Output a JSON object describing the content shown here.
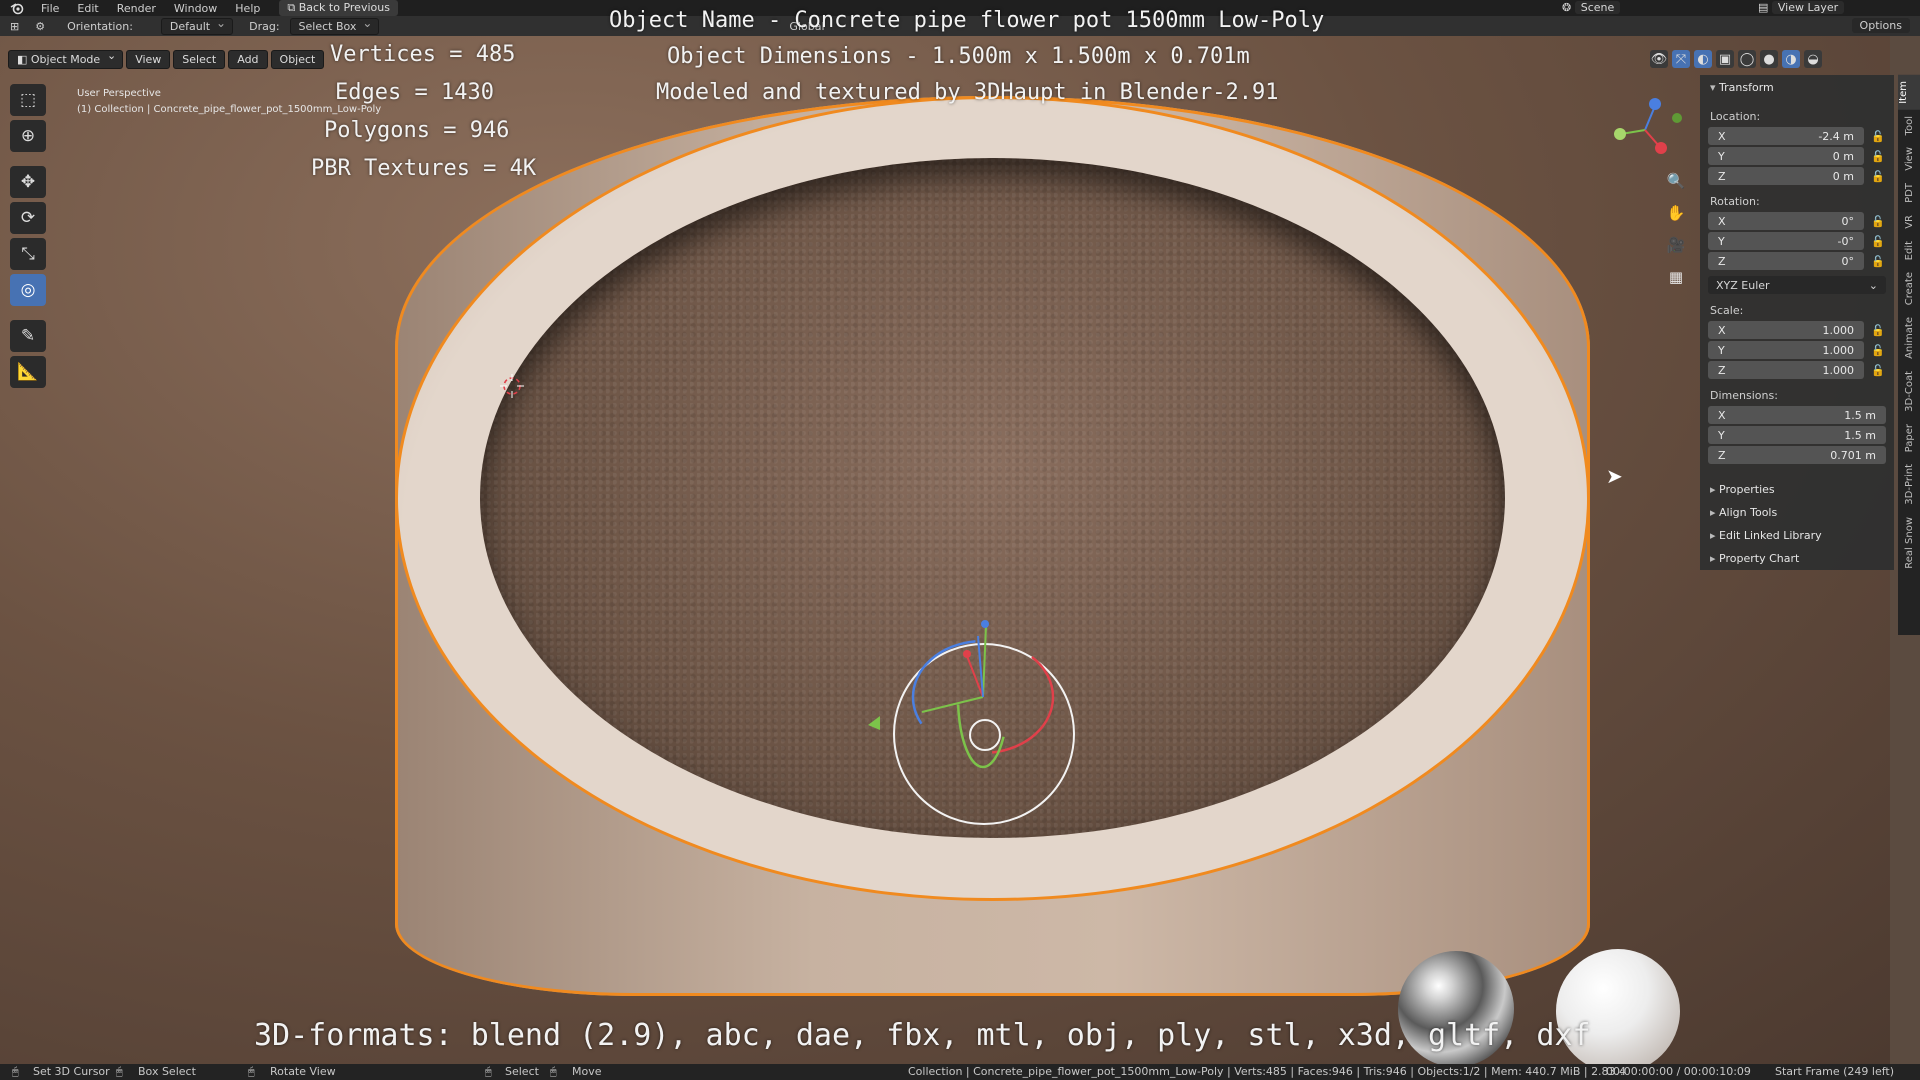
{
  "topbar": {
    "menus": [
      "File",
      "Edit",
      "Render",
      "Window",
      "Help"
    ],
    "back_button": "Back to Previous",
    "scene": "Scene",
    "view_layer": "View Layer"
  },
  "header": {
    "orientation_label": "Orientation:",
    "orientation_value": "Default",
    "drag_label": "Drag:",
    "drag_value": "Select Box",
    "transform_space": "Global",
    "options": "Options"
  },
  "mode_row": {
    "mode": "Object Mode",
    "view": "View",
    "select": "Select",
    "add": "Add",
    "object": "Object"
  },
  "view_info": {
    "perspective": "User Perspective",
    "collection": "(1) Collection | Concrete_pipe_flower_pot_1500mm_Low-Poly"
  },
  "overlay": {
    "object_name": "Object Name - Concrete pipe flower pot 1500mm Low-Poly",
    "dimensions": "Object Dimensions - 1.500m x 1.500m x 0.701m",
    "modeled": "Modeled and textured by 3DHaupt in Blender-2.91",
    "vertices": "Vertices = 485",
    "edges": "Edges = 1430",
    "polygons": "Polygons = 946",
    "pbr": "PBR Textures = 4K",
    "formats": "3D-formats: blend (2.9), abc, dae, fbx, mtl, obj, ply, stl, x3d, gltf, dxf"
  },
  "npanel": {
    "transform": "Transform",
    "location_label": "Location:",
    "location": {
      "x": "-2.4 m",
      "y": "0 m",
      "z": "0 m"
    },
    "rotation_label": "Rotation:",
    "rotation": {
      "x": "0°",
      "y": "-0°",
      "z": "0°"
    },
    "rotation_mode": "XYZ Euler",
    "scale_label": "Scale:",
    "scale": {
      "x": "1.000",
      "y": "1.000",
      "z": "1.000"
    },
    "dimensions_label": "Dimensions:",
    "dimensions": {
      "x": "1.5 m",
      "y": "1.5 m",
      "z": "0.701 m"
    },
    "axis": {
      "x": "X",
      "y": "Y",
      "z": "Z"
    },
    "properties": "Properties",
    "align_tools": "Align Tools",
    "edit_linked_library": "Edit Linked Library",
    "property_chart": "Property Chart"
  },
  "vtabs": [
    "Item",
    "Tool",
    "View",
    "PDT",
    "VR",
    "Edit",
    "Create",
    "Animate",
    "3D-Coat",
    "Paper",
    "3D-Print",
    "Real Snow"
  ],
  "statusbar": {
    "set_cursor": "Set 3D Cursor",
    "box_select": "Box Select",
    "rotate_view": "Rotate View",
    "select": "Select",
    "move": "Move",
    "stats": "Collection | Concrete_pipe_flower_pot_1500mm_Low-Poly | Verts:485 | Faces:946 | Tris:946 | Objects:1/2 | Mem: 440.7 MiB | 2.83.4",
    "time": "00:00:00:00 / 00:00:10:09",
    "start_frame": "Start Frame (249 left)"
  },
  "colors": {
    "selection_outline": "#f08a1f",
    "active_tool": "#4772b3",
    "gizmo_x": "#e0404a",
    "gizmo_y": "#7cc34a",
    "gizmo_z": "#4a7fe0"
  }
}
